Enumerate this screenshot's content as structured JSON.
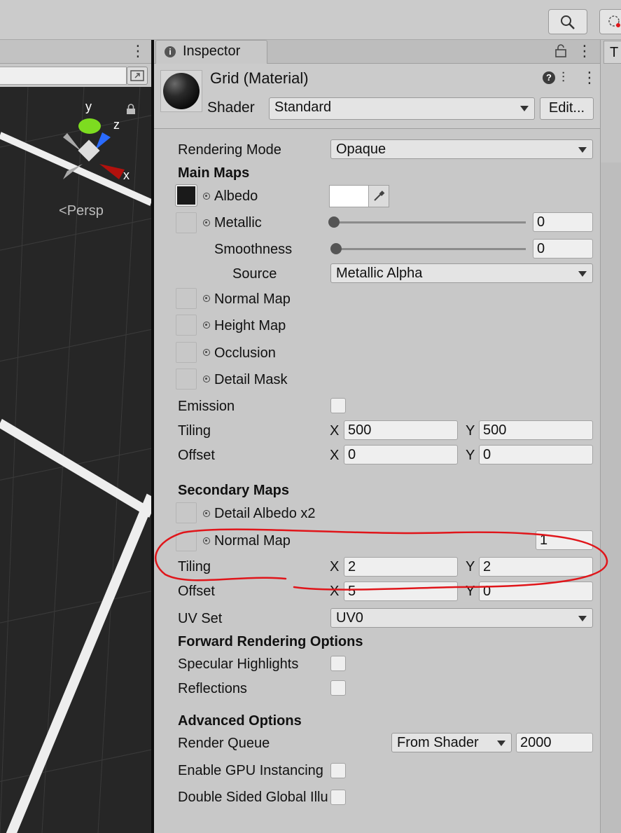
{
  "scene": {
    "view_mode": "Persp",
    "gizmo_axes": {
      "y": "y",
      "z": "z",
      "x": "x"
    }
  },
  "inspector": {
    "tab_label": "Inspector",
    "right_panel_tab": "T",
    "material_title": "Grid (Material)",
    "shader_label": "Shader",
    "shader_value": "Standard",
    "edit_button": "Edit...",
    "rendering_mode_label": "Rendering Mode",
    "rendering_mode_value": "Opaque",
    "main_maps": {
      "heading": "Main Maps",
      "albedo": "Albedo",
      "albedo_color": "#ffffff",
      "metallic": "Metallic",
      "metallic_value": "0",
      "smoothness": "Smoothness",
      "smoothness_value": "0",
      "source": "Source",
      "source_value": "Metallic Alpha",
      "normal_map": "Normal Map",
      "height_map": "Height Map",
      "occlusion": "Occlusion",
      "detail_mask": "Detail Mask",
      "emission": "Emission",
      "tiling": "Tiling",
      "tiling_x": "500",
      "tiling_y": "500",
      "offset": "Offset",
      "offset_x": "0",
      "offset_y": "0"
    },
    "secondary_maps": {
      "heading": "Secondary Maps",
      "detail_albedo": "Detail Albedo x2",
      "normal_map": "Normal Map",
      "normal_scale": "1",
      "tiling": "Tiling",
      "tiling_x": "2",
      "tiling_y": "2",
      "offset": "Offset",
      "offset_x": "5",
      "offset_y": "0",
      "uv_set": "UV Set",
      "uv_set_value": "UV0"
    },
    "forward_rendering": {
      "heading": "Forward Rendering Options",
      "specular": "Specular Highlights",
      "reflections": "Reflections"
    },
    "advanced": {
      "heading": "Advanced Options",
      "render_queue": "Render Queue",
      "render_queue_mode": "From Shader",
      "render_queue_value": "2000",
      "gpu_instancing": "Enable GPU Instancing",
      "double_sided_gi": "Double Sided Global Illumination"
    },
    "axis_x": "X",
    "axis_y": "Y"
  },
  "annotation_color": "#e0151a"
}
